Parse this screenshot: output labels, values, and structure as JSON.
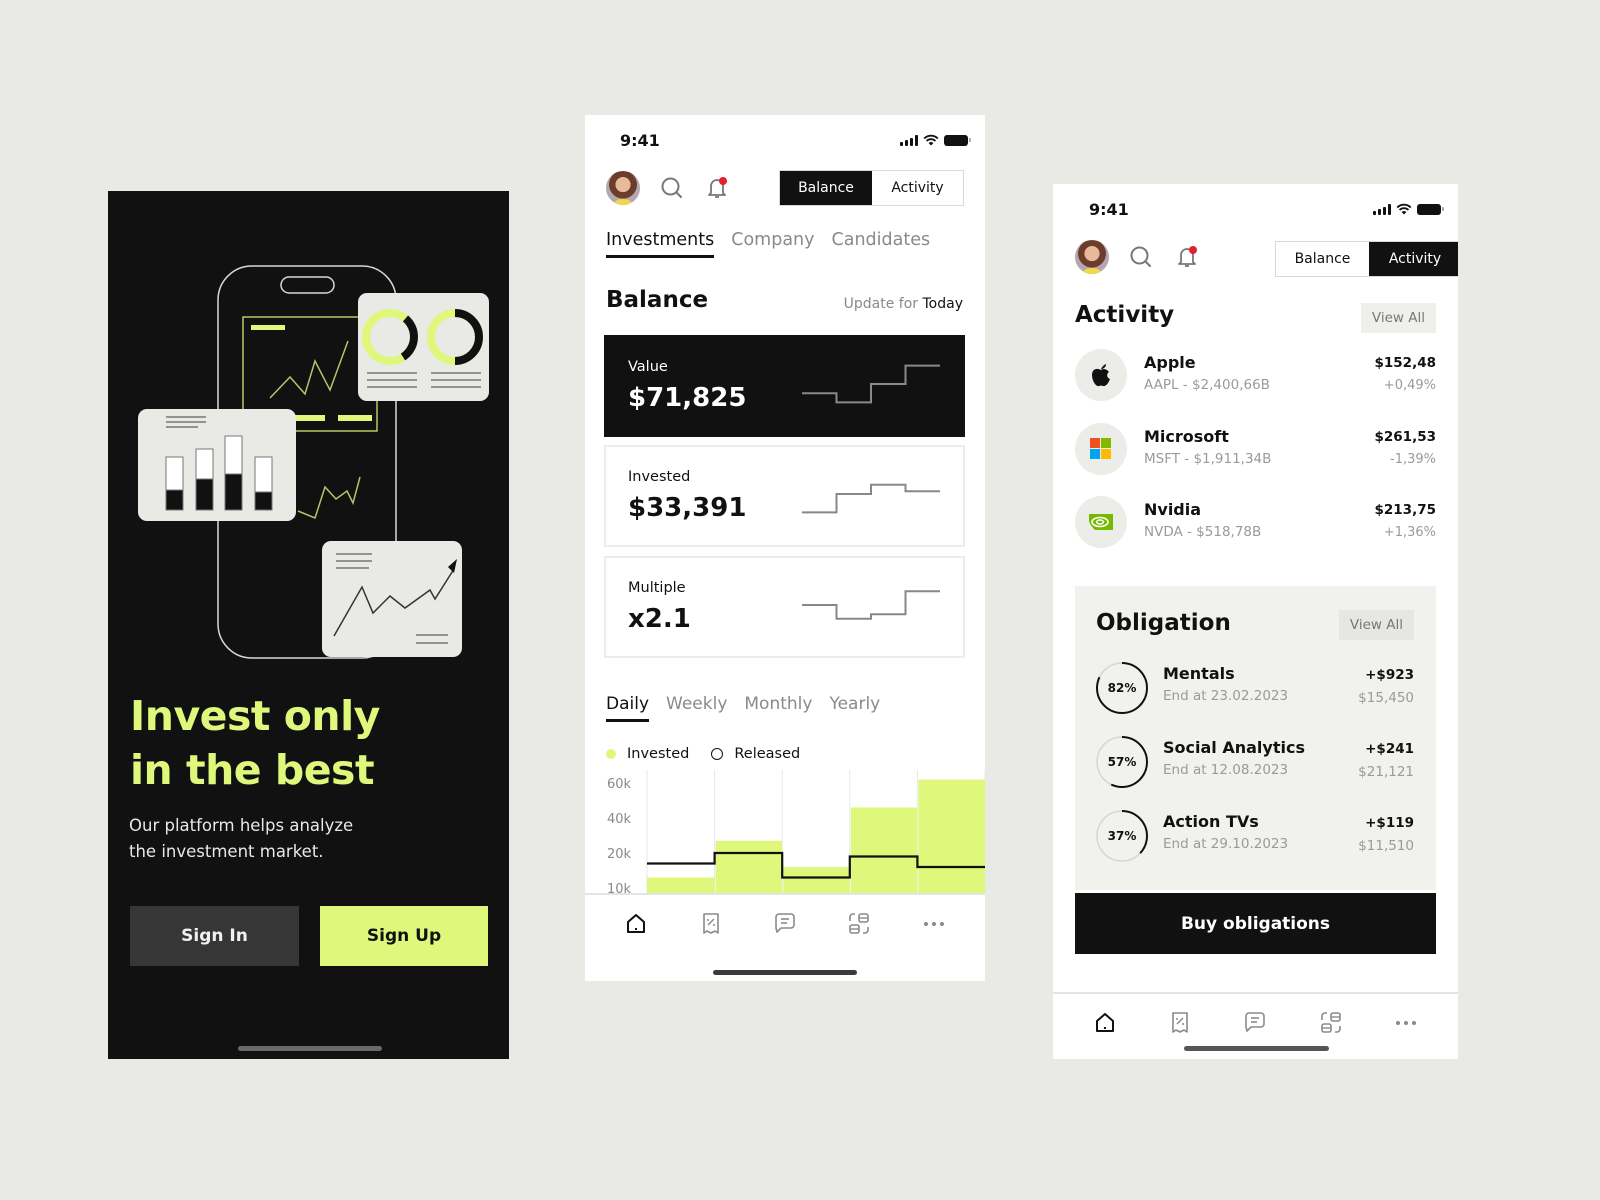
{
  "onboarding": {
    "headline_line1": "Invest only",
    "headline_line2": "in the best",
    "subtitle_line1": "Our platform helps analyze",
    "subtitle_line2": "the investment market.",
    "sign_in_label": "Sign In",
    "sign_up_label": "Sign Up",
    "accent_color": "#dff77b"
  },
  "balance_screen": {
    "status_time": "9:41",
    "segment": {
      "balance_label": "Balance",
      "activity_label": "Activity",
      "active": "Balance"
    },
    "tabs": [
      {
        "label": "Investments",
        "active": true
      },
      {
        "label": "Company",
        "active": false
      },
      {
        "label": "Candidates",
        "active": false
      }
    ],
    "section_title": "Balance",
    "update_prefix": "Update for",
    "update_value": "Today",
    "kpis": [
      {
        "label": "Value",
        "value": "$71,825",
        "dark": true,
        "spark": [
          2,
          1,
          3,
          5
        ]
      },
      {
        "label": "Invested",
        "value": "$33,391",
        "dark": false,
        "spark": [
          1,
          3,
          4,
          3.3
        ]
      },
      {
        "label": "Multiple",
        "value": "x2.1",
        "dark": false,
        "spark": [
          3,
          1.5,
          2,
          4.5
        ]
      }
    ],
    "period_tabs": [
      {
        "label": "Daily",
        "active": true
      },
      {
        "label": "Weekly",
        "active": false
      },
      {
        "label": "Monthly",
        "active": false
      },
      {
        "label": "Yearly",
        "active": false
      }
    ],
    "legend": {
      "invested_label": "Invested",
      "released_label": "Released"
    },
    "chart_data": {
      "type": "area",
      "title": "",
      "xlabel": "",
      "ylabel": "",
      "y_ticks": [
        "60k",
        "40k",
        "20k",
        "10k"
      ],
      "grid": true,
      "series": [
        {
          "name": "Invested",
          "style": "filled-step",
          "color": "#dff77b",
          "values": [
            13,
            27,
            16,
            46,
            62
          ]
        },
        {
          "name": "Released",
          "style": "step-line",
          "color": "#111111",
          "values": [
            17,
            20,
            13,
            19,
            16
          ]
        }
      ]
    }
  },
  "activity_screen": {
    "status_time": "9:41",
    "segment": {
      "balance_label": "Balance",
      "activity_label": "Activity",
      "active": "Activity"
    },
    "activity_title": "Activity",
    "view_all_label": "View All",
    "stocks": [
      {
        "name": "Apple",
        "meta": "AAPL - $2,400,66B",
        "price": "$152,48",
        "change": "+0,49%",
        "logo": "apple-logo-icon"
      },
      {
        "name": "Microsoft",
        "meta": "MSFT - $1,911,34B",
        "price": "$261,53",
        "change": "-1,39%",
        "logo": "microsoft-logo-icon"
      },
      {
        "name": "Nvidia",
        "meta": "NVDA - $518,78B",
        "price": "$213,75",
        "change": "+1,36%",
        "logo": "nvidia-logo-icon"
      }
    ],
    "obligation_title": "Obligation",
    "obligation_view_all_label": "View All",
    "obligations": [
      {
        "percent_label": "82%",
        "progress": 0.82,
        "name": "Mentals",
        "end": "End at 23.02.2023",
        "gain": "+$923",
        "total": "$15,450"
      },
      {
        "percent_label": "57%",
        "progress": 0.57,
        "name": "Social Analytics",
        "end": "End at 12.08.2023",
        "gain": "+$241",
        "total": "$21,121"
      },
      {
        "percent_label": "37%",
        "progress": 0.37,
        "name": "Action TVs",
        "end": "End at 29.10.2023",
        "gain": "+$119",
        "total": "$11,510"
      }
    ],
    "buy_label": "Buy obligations"
  },
  "nav_items": [
    "home-icon",
    "discount-receipt-icon",
    "chat-icon",
    "apps-icon",
    "more-icon"
  ]
}
